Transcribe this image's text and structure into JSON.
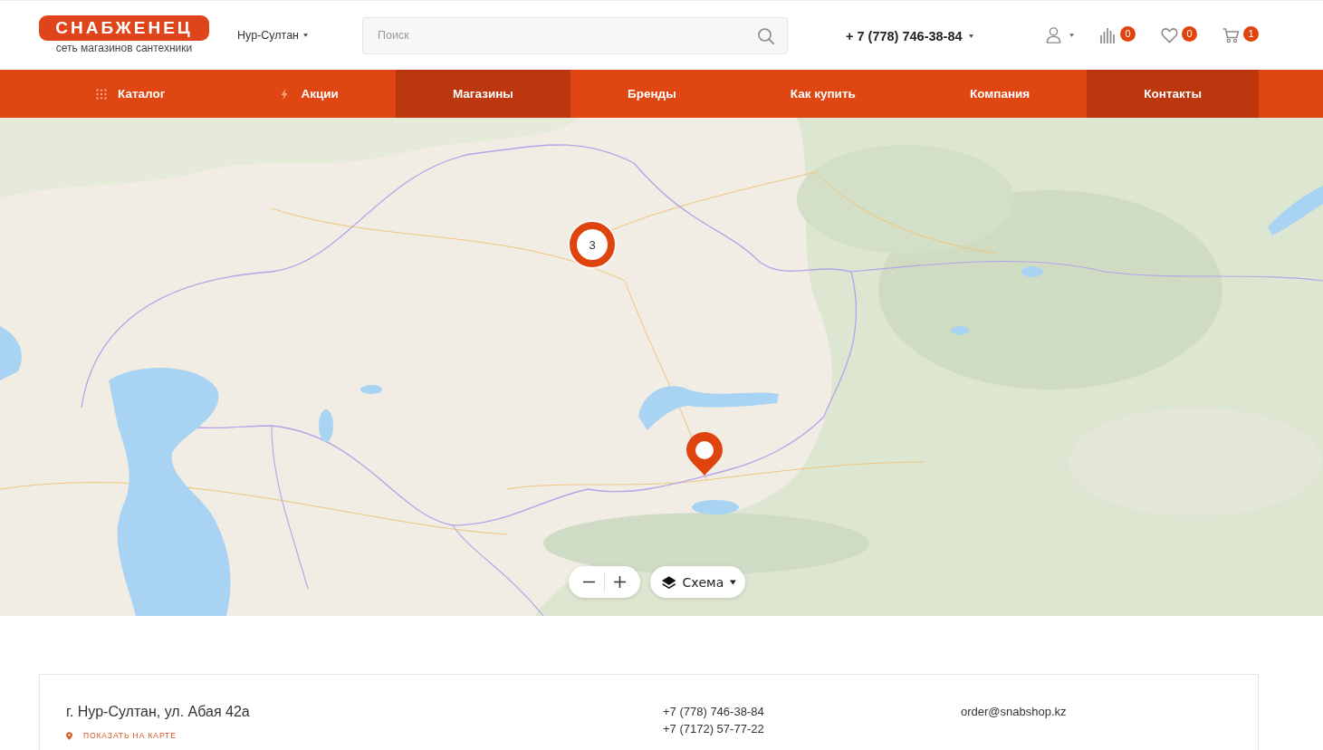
{
  "header": {
    "logo": {
      "wordmark": "СНАБЖЕНЕЦ",
      "tagline": "сеть магазинов сантехники"
    },
    "city": "Нур-Султан",
    "search": {
      "placeholder": "Поиск"
    },
    "phone": "+ 7 (778) 746-38-84",
    "actions": [
      {
        "kind": "account"
      },
      {
        "kind": "compare",
        "count": "0"
      },
      {
        "kind": "favorites",
        "count": "0"
      },
      {
        "kind": "cart",
        "count": "1"
      }
    ]
  },
  "nav": [
    {
      "label": "Каталог",
      "kind": "catalog",
      "selected": false
    },
    {
      "label": "Акции",
      "kind": "promo",
      "selected": false
    },
    {
      "label": "Магазины",
      "kind": "page",
      "selected": true
    },
    {
      "label": "Бренды",
      "kind": "page",
      "selected": false
    },
    {
      "label": "Как купить",
      "kind": "page",
      "selected": false
    },
    {
      "label": "Компания",
      "kind": "page",
      "selected": false
    },
    {
      "label": "Контакты",
      "kind": "page",
      "selected": true
    }
  ],
  "map": {
    "markers": [
      {
        "kind": "cluster",
        "count": "3"
      },
      {
        "kind": "pin"
      }
    ],
    "map_type": "Схема"
  },
  "store": {
    "address": "г. Нур-Султан, ул. Абая 42а",
    "map_link": "ПОКАЗАТЬ НА КАРТЕ",
    "phones": [
      "+7 (778) 746-38-84",
      "+7 (7172) 57-77-22"
    ],
    "email": "order@snabshop.kz"
  }
}
